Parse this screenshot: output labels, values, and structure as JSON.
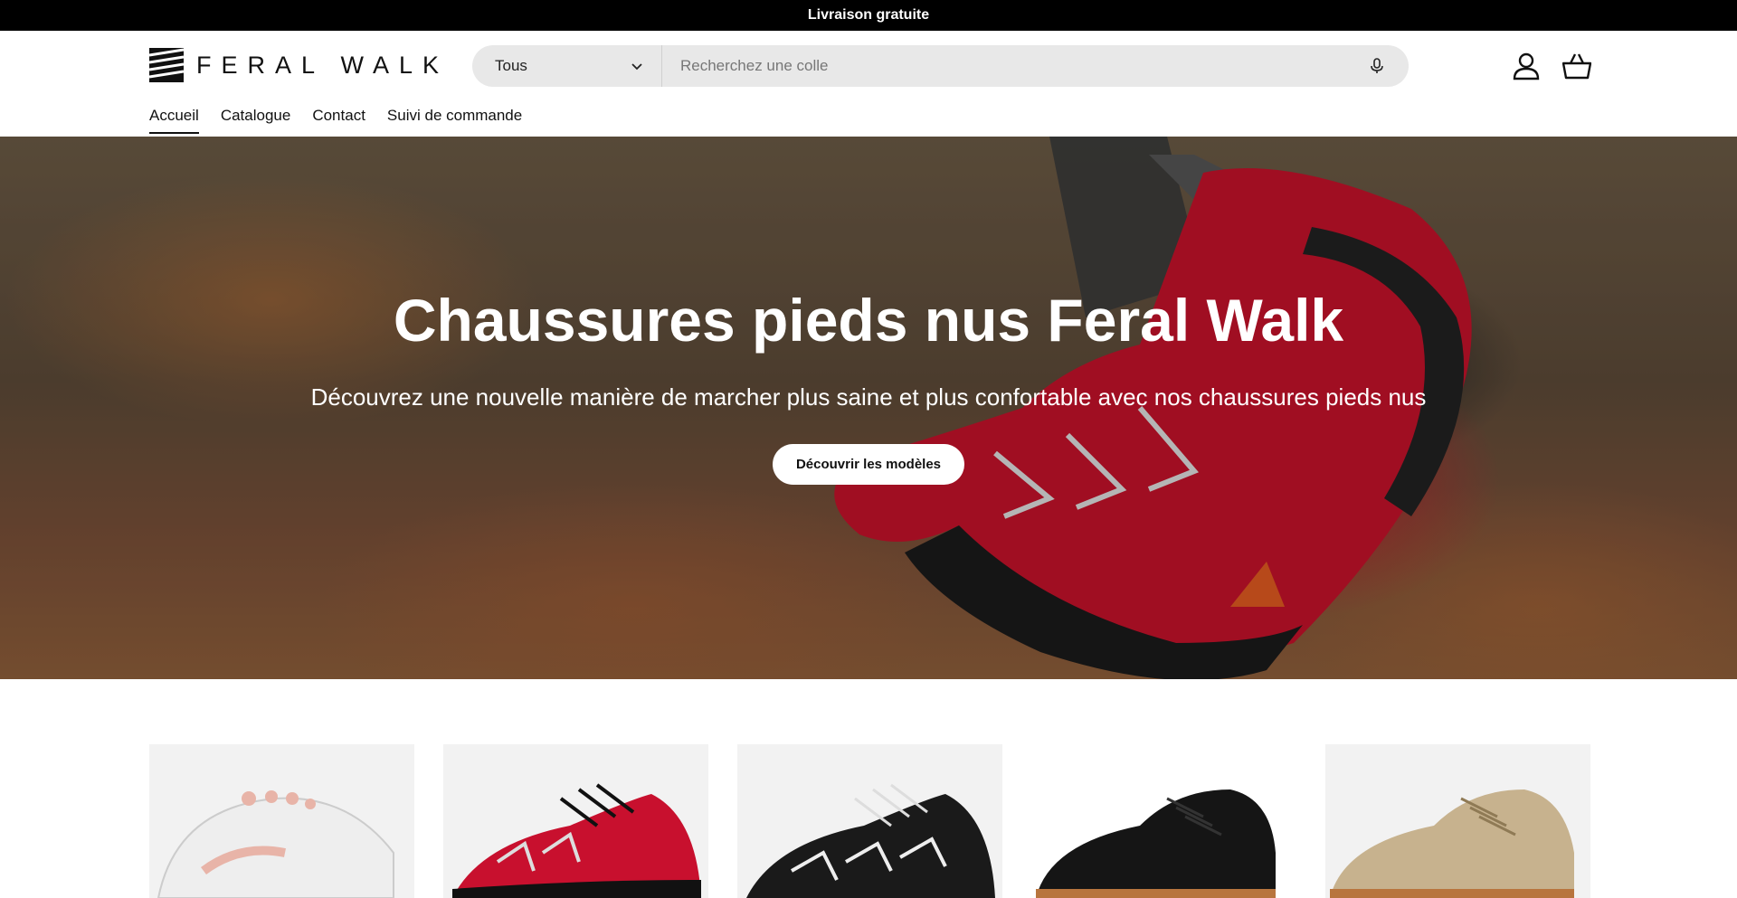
{
  "announcement": "Livraison gratuite",
  "brand": {
    "name": "FERAL WALK"
  },
  "search": {
    "category": "Tous",
    "placeholder": "Recherchez une colle"
  },
  "nav": {
    "items": [
      {
        "label": "Accueil",
        "active": true
      },
      {
        "label": "Catalogue",
        "active": false
      },
      {
        "label": "Contact",
        "active": false
      },
      {
        "label": "Suivi de commande",
        "active": false
      }
    ]
  },
  "hero": {
    "title": "Chaussures pieds nus Feral Walk",
    "subtitle": "Découvrez une nouvelle manière de marcher plus saine et plus confortable avec nos chaussures pieds nus",
    "button": "Découvrir les modèles"
  },
  "products": [
    {
      "icon": "white-pink-shoe-image",
      "color": "#e8b4a8"
    },
    {
      "icon": "red-black-shoe-image",
      "color": "#c8102e"
    },
    {
      "icon": "black-white-shoe-image",
      "color": "#1a1a1a"
    },
    {
      "icon": "black-suede-shoe-image",
      "color": "#151515"
    },
    {
      "icon": "beige-shoe-image",
      "color": "#c7b28e"
    }
  ]
}
